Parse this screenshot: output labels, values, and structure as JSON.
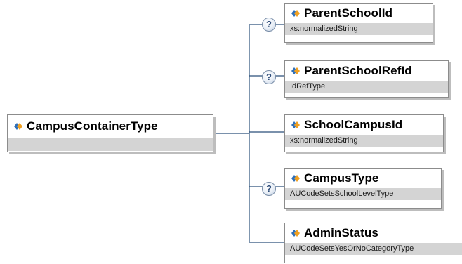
{
  "root": {
    "name": "CampusContainerType",
    "footer": ""
  },
  "elements": [
    {
      "name": "ParentSchoolId",
      "type": "xs:normalizedString",
      "optional": true
    },
    {
      "name": "ParentSchoolRefId",
      "type": "IdRefType",
      "optional": true
    },
    {
      "name": "SchoolCampusId",
      "type": "xs:normalizedString",
      "optional": false
    },
    {
      "name": "CampusType",
      "type": "AUCodeSetsSchoolLevelType",
      "optional": true
    },
    {
      "name": "AdminStatus",
      "type": "AUCodeSetsYesOrNoCategoryType",
      "optional": false
    }
  ],
  "optional_marker": "?",
  "colors": {
    "connector": "#2a4f7a",
    "footer_bg": "#d4d4d4",
    "box_border": "#8c8c8c",
    "icon_blue": "#2f6fb8",
    "icon_orange": "#f0a020"
  }
}
